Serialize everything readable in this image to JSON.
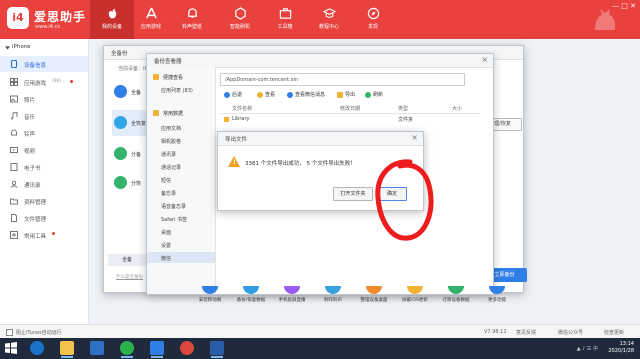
{
  "header": {
    "logo_mark": "i4",
    "logo_title": "爱思助手",
    "logo_url": "www.i4.cn",
    "nav": [
      {
        "label": "我的设备",
        "icon": "apple-icon",
        "active": true
      },
      {
        "label": "应用游戏",
        "icon": "apps-icon",
        "active": false
      },
      {
        "label": "铃声壁纸",
        "icon": "bell-icon",
        "active": false
      },
      {
        "label": "智能刷机",
        "icon": "cube-icon",
        "active": false
      },
      {
        "label": "工具箱",
        "icon": "toolbox-icon",
        "active": false
      },
      {
        "label": "教程中心",
        "icon": "graduation-icon",
        "active": false
      },
      {
        "label": "发现",
        "icon": "compass-icon",
        "active": false
      }
    ],
    "window_controls": "— □ ✕"
  },
  "sidebar": {
    "device": "iPhone",
    "items": [
      {
        "label": "设备信息",
        "icon": "device-info-icon",
        "active": true
      },
      {
        "label": "应用游戏",
        "badge": "(98)",
        "icon": "apps-icon"
      },
      {
        "label": "照片",
        "icon": "photo-icon"
      },
      {
        "label": "音乐",
        "icon": "music-icon"
      },
      {
        "label": "铃声",
        "icon": "bell-icon"
      },
      {
        "label": "视频",
        "icon": "video-icon"
      },
      {
        "label": "电子书",
        "icon": "book-icon"
      },
      {
        "label": "通讯录",
        "icon": "contacts-icon"
      },
      {
        "label": "资料管理",
        "icon": "folder-icon"
      },
      {
        "label": "文件管理",
        "icon": "file-icon"
      },
      {
        "label": "常用工具",
        "icon": "tools-icon"
      }
    ]
  },
  "backup_dialog": {
    "title": "全备份",
    "device_label": "当前设备：iP",
    "rows": [
      {
        "label": "全备",
        "color": "#2f7fe6"
      },
      {
        "label": "全恢复",
        "color": "#2fa7e6"
      },
      {
        "label": "分备",
        "color": "#34b36a"
      },
      {
        "label": "分恢",
        "color": "#34b36a"
      }
    ],
    "link": "什么是全备份",
    "restore_button": "管理/恢复",
    "start_button": "立即备份"
  },
  "viewer": {
    "title": "备份查看器",
    "sections": [
      {
        "label": "便捷查看",
        "items": [
          "应用列表 (83)"
        ]
      },
      {
        "label": "常用数据",
        "items": [
          "应用文档",
          "相机胶卷",
          "通讯录",
          "通话记录",
          "短信",
          "备忘录",
          "语音备忘录",
          "Safari 书签",
          "桌面",
          "设置",
          "微信"
        ]
      }
    ],
    "active_item": "微信",
    "path": "/AppDomain-com.tencent.xin",
    "toolbar": [
      "后退",
      "查看",
      "查看微信消息",
      "导出",
      "刷新"
    ],
    "columns": [
      "文件名称",
      "修改日期",
      "类型",
      "大小"
    ],
    "rows": [
      {
        "name": "Library",
        "type": "文件夹"
      }
    ]
  },
  "export_dialog": {
    "title": "导出文件",
    "message": "3381 个文件导出成功， 5 个文件导出失败！",
    "open_folder_button": "打开文件夹",
    "ok_button": "确定"
  },
  "tools": [
    {
      "label": "安装移动端",
      "color": "#2f7fe6"
    },
    {
      "label": "备份/恢复数据",
      "color": "#2f9ee6"
    },
    {
      "label": "手机投屏直播",
      "color": "#9a5cf0"
    },
    {
      "label": "制作铃声",
      "color": "#3aa0e0"
    },
    {
      "label": "整理设备桌面",
      "color": "#f08a2a"
    },
    {
      "label": "屏蔽iOS更新",
      "color": "#f2b233"
    },
    {
      "label": "迁移设备数据",
      "color": "#34b36a"
    },
    {
      "label": "更多功能",
      "color": "#2f7fe6"
    }
  ],
  "statusbar": {
    "itunes_checkbox": "阻止iTunes自动运行",
    "version": "V7.98.12",
    "feedback": "意见反馈",
    "wechat": "微信公众号",
    "update": "检查更新"
  },
  "taskbar": {
    "time": "13:14",
    "date": "2020/1/28",
    "apps": [
      "windows-start-icon",
      "ie-icon",
      "folder-icon",
      "store-icon",
      "wechat-icon",
      "i4-icon",
      "media-icon",
      "word-icon"
    ]
  },
  "colors": {
    "brand_red": "#e8413e",
    "accent_blue": "#2f7fe6"
  }
}
